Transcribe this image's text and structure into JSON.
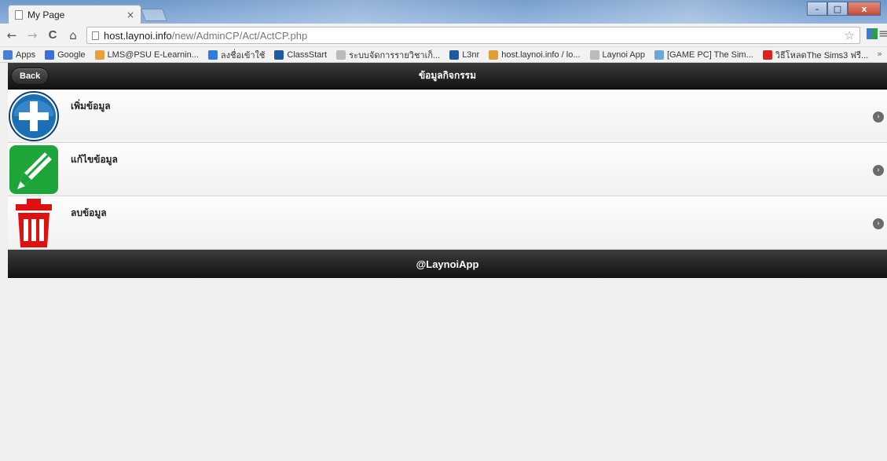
{
  "browser": {
    "tab_title": "My Page",
    "tab_close": "×",
    "url_host": "host.laynoi.info",
    "url_path": "/new/AdminCP/Act/ActCP.php",
    "back_icon": "←",
    "forward_icon": "→",
    "reload_icon": "C",
    "home_icon": "⌂",
    "star_icon": "☆",
    "menu_icon": "≡",
    "window_buttons": {
      "minimize": "–",
      "maximize": "□",
      "close": "x"
    },
    "bookmarks": [
      {
        "label": "Apps",
        "color": "#4a7fd6"
      },
      {
        "label": "Google",
        "color": "#3b6fd4"
      },
      {
        "label": "LMS@PSU E-Learnin...",
        "color": "#e8a040"
      },
      {
        "label": "ลงชื่อเข้าใช้",
        "color": "#2f7fd8"
      },
      {
        "label": "ClassStart",
        "color": "#1e5aa0"
      },
      {
        "label": "ระบบจัดการรายวิชาเก็...",
        "color": "#bbbbbb"
      },
      {
        "label": "L3nr",
        "color": "#1e5aa0"
      },
      {
        "label": "host.laynoi.info / lo...",
        "color": "#e0a030"
      },
      {
        "label": "Laynoi App",
        "color": "#bbbbbb"
      },
      {
        "label": "[GAME PC] The Sim...",
        "color": "#6aa8d8"
      },
      {
        "label": "วิธีโหลดThe Sims3 ฟรี...",
        "color": "#d22"
      }
    ],
    "bookmarks_more": "»"
  },
  "page": {
    "back_label": "Back",
    "title": "ข้อมูลกิจกรรม",
    "items": [
      {
        "label": "เพิ่มข้อมูล",
        "icon": "add-icon"
      },
      {
        "label": "แก้ไขข้อมูล",
        "icon": "edit-icon"
      },
      {
        "label": "ลบข้อมูล",
        "icon": "trash-icon"
      }
    ],
    "arrow_glyph": "›",
    "footer": "@LaynoiApp"
  },
  "colors": {
    "header_bg": "#1a1a1a",
    "add_icon": "#1b6fb5",
    "edit_icon": "#1ea53a",
    "trash_icon": "#e01010"
  }
}
